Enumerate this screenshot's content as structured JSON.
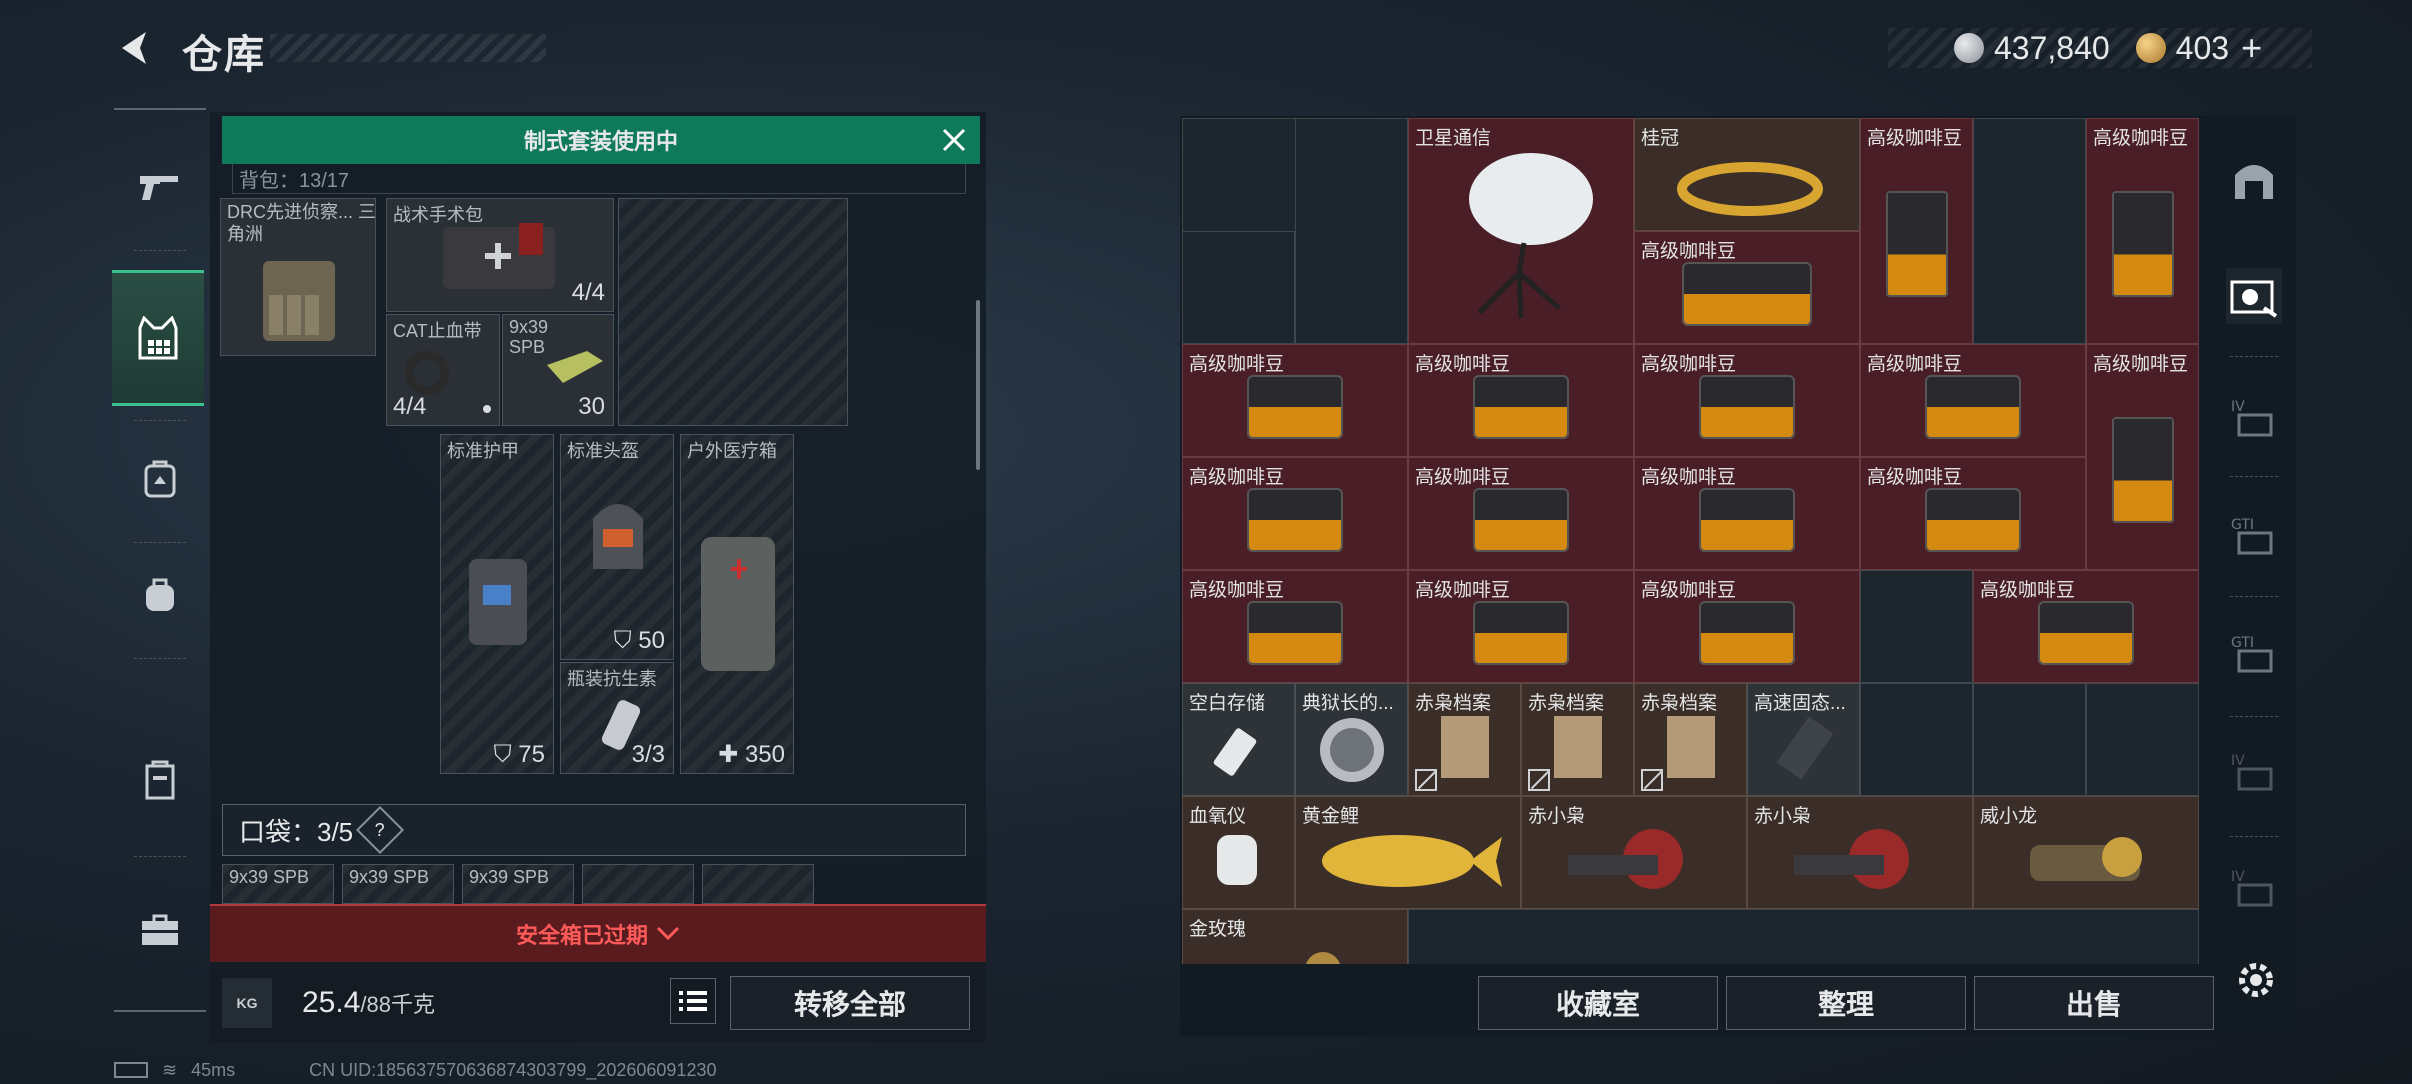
{
  "header": {
    "title": "仓库"
  },
  "currency": {
    "silver": "437,840",
    "gold": "403",
    "plus": "+"
  },
  "banner": {
    "text": "制式套装使用中"
  },
  "backpack_header": {
    "text": "背包：13/17"
  },
  "left_items": [
    {
      "label": "DRC先进侦察... 三角洲"
    },
    {
      "label": "战术手术包",
      "count": "4/4"
    },
    {
      "label": "CAT止血带",
      "count": "4/4"
    },
    {
      "label": "9x39 SPB",
      "count": "30"
    },
    {
      "label": "标准护甲",
      "value": "75"
    },
    {
      "label": "标准头盔",
      "value": "50"
    },
    {
      "label": "瓶装抗生素",
      "count": "3/3"
    },
    {
      "label": "户外医疗箱",
      "value": "350"
    }
  ],
  "pocket": {
    "label": "口袋：3/5",
    "help": "?"
  },
  "pocket_items": [
    "9x39 SPB",
    "9x39 SPB",
    "9x39 SPB"
  ],
  "safebox": {
    "text": "安全箱已过期"
  },
  "weight": {
    "current": "25.4",
    "max": "/88千克",
    "kg_label": "KG"
  },
  "left_actions": {
    "transfer_all": "转移全部"
  },
  "grid_items": {
    "satellite": "卫星通信",
    "crown": "桂冠",
    "coffee": "高级咖啡豆",
    "empty_storage": "空白存储",
    "mayor": "典狱长的...",
    "owl_file": "赤枭档案",
    "ssd": "高速固态...",
    "oximeter": "血氧仪",
    "carp": "黄金鲤",
    "owl": "赤小枭",
    "dragon": "威小龙",
    "rose": "金玫瑰"
  },
  "right_actions": {
    "collection": "收藏室",
    "sort": "整理",
    "sell": "出售"
  },
  "status": {
    "ping": "45ms",
    "uid": "CN UID:185637570636874303799_202606091230"
  },
  "colors": {
    "accent_green": "#0f7a5a",
    "danger_red": "#5a1b1e",
    "coffee_orange": "#d48a10"
  }
}
